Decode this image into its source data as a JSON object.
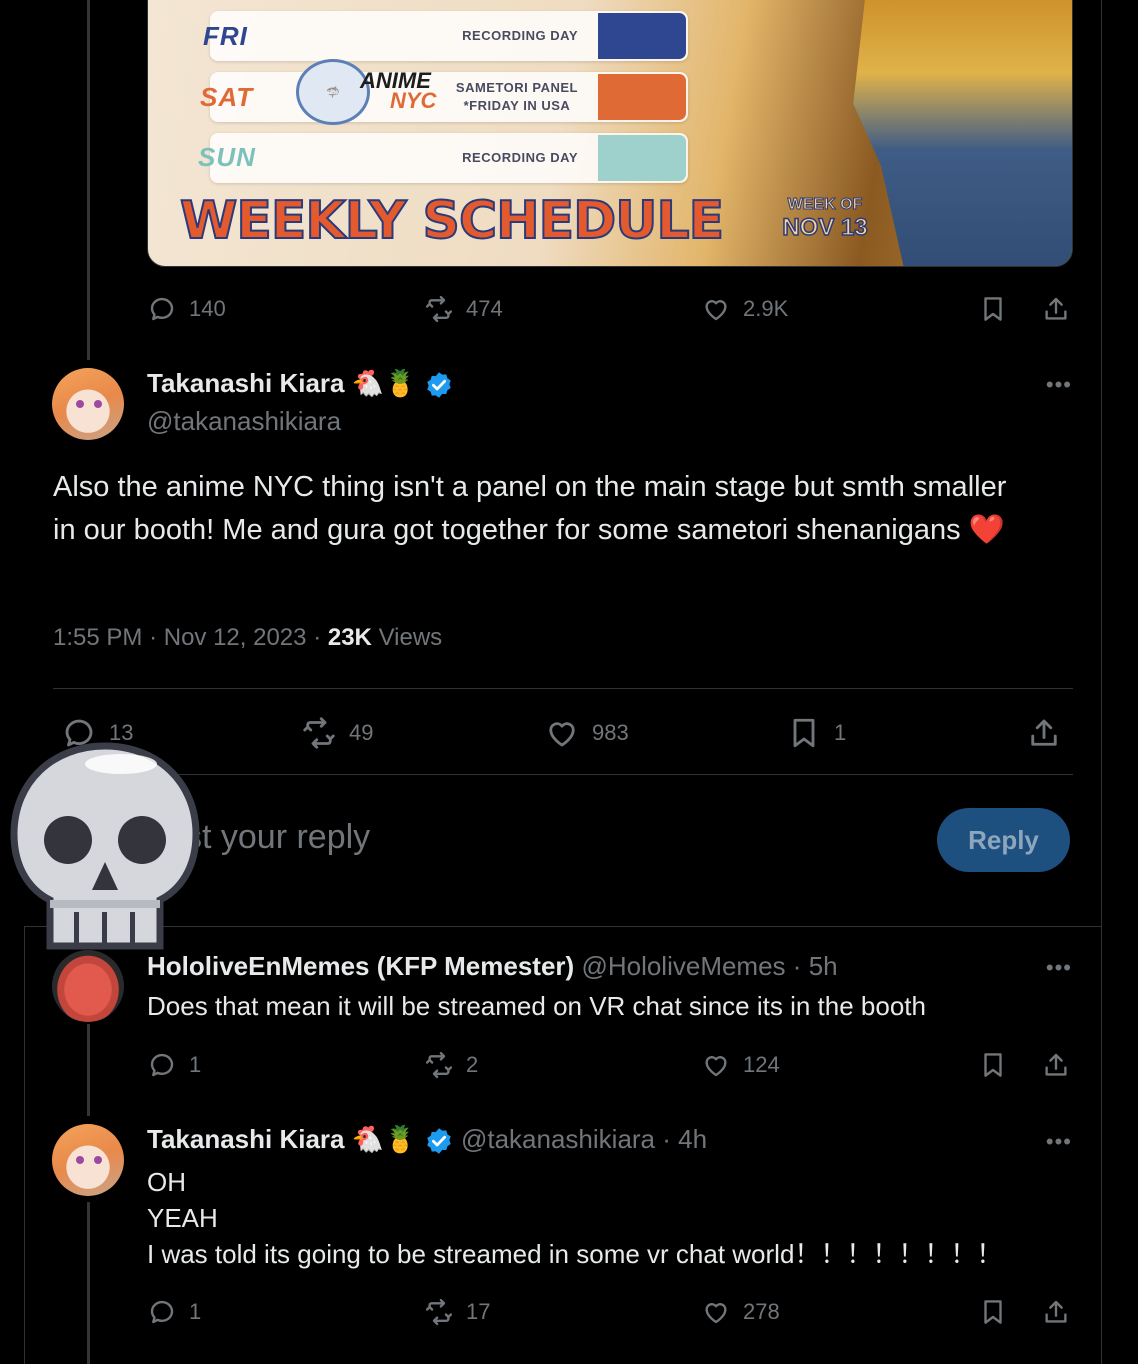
{
  "schedule": {
    "rows": [
      {
        "day": "FRI",
        "note_line1": "RECORDING DAY",
        "note_line2": "",
        "color": "#2f4690"
      },
      {
        "day": "SAT",
        "note_line1": "SAMETORI PANEL",
        "note_line2": "*FRIDAY IN USA",
        "color": "#e06a36"
      },
      {
        "day": "SUN",
        "note_line1": "RECORDING DAY",
        "note_line2": "",
        "color": "#9fd1cc"
      }
    ],
    "logo_line1": "ANIME",
    "logo_line2": "NYC",
    "title": "WEEKLY SCHEDULE",
    "week_of": "WEEK OF",
    "week_date": "NOV 13"
  },
  "top_post_actions": {
    "replies": "140",
    "reposts": "474",
    "likes": "2.9K"
  },
  "main_post": {
    "name": "Takanashi Kiara",
    "emojis": "🐔🍍",
    "handle": "@takanashikiara",
    "text": "Also the anime NYC thing isn't a panel on the main stage but smth smaller in our booth! Me and gura got together for some sametori shenanigans ❤️",
    "time": "1:55 PM",
    "sep": "·",
    "date": "Nov 12, 2023",
    "views_count": "23K",
    "views_label": "Views",
    "more": "•••",
    "stats": {
      "replies": "13",
      "reposts": "49",
      "likes": "983",
      "bookmarks": "1"
    }
  },
  "composer": {
    "placeholder": "st your reply",
    "button": "Reply"
  },
  "replies": [
    {
      "name": "HololiveEnMemes (KFP Memester)",
      "handle": "@HololiveMemes",
      "age": "5h",
      "lines": [
        "Does that mean it will be streamed on VR chat since its in the booth"
      ],
      "stats": {
        "replies": "1",
        "reposts": "2",
        "likes": "124"
      }
    },
    {
      "name": "Takanashi Kiara",
      "emojis": "🐔🍍",
      "handle": "@takanashikiara",
      "age": "4h",
      "lines": [
        "OH",
        "YEAH",
        "I was told its going to be streamed in some vr chat world！！！！！！！！"
      ],
      "stats": {
        "replies": "1",
        "reposts": "17",
        "likes": "278"
      }
    }
  ],
  "colors": {
    "accent": "#1d9bf0",
    "muted": "#71767b",
    "reply_button": "#1d4f7f",
    "background": "#000000"
  }
}
